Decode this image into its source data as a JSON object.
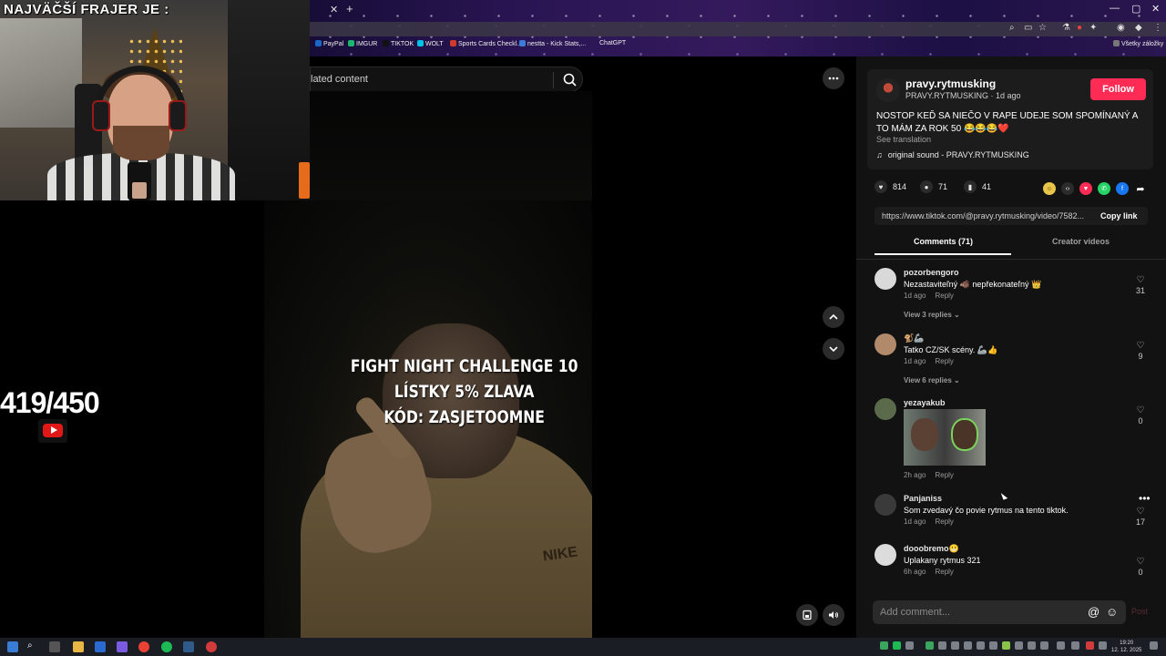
{
  "overlay": {
    "webcam_title": "NAJVÄČŠÍ FRAJER JE :",
    "counter": "419/450"
  },
  "bookmarks": [
    {
      "label": "PayPal",
      "color": "#1a66c9"
    },
    {
      "label": "IMGUR",
      "color": "#1bb76e"
    },
    {
      "label": "TIKTOK",
      "color": "#111111"
    },
    {
      "label": "WOLT",
      "color": "#00c2e8"
    },
    {
      "label": "Sports Cards Checkl...",
      "color": "#d0392b"
    },
    {
      "label": "nestta - Kick Stats,...",
      "color": "#3c7bd9"
    },
    {
      "label": "ChatGPT",
      "color": "#222222"
    },
    {
      "label": "Všetky záložky",
      "color": "#444444"
    }
  ],
  "search": {
    "placeholder": "lated content"
  },
  "video": {
    "caption_lines": [
      "FIGHT NIGHT CHALLENGE 10",
      "LÍSTKY 5% ZLAVA",
      "KÓD: ZASJETOOMNE"
    ],
    "brand_text": "NIKE"
  },
  "post": {
    "author": "pravy.rytmusking",
    "author_sub": "PRAVY.RYTMUSKING · 1d ago",
    "follow_label": "Follow",
    "description": "NOSTOP KEĎ SA NIEČO V RAPE UDEJE SOM SPOMÍNANÝ A TO MÁM ZA ROK 50 😂😂😂❤️",
    "see_translation": "See translation",
    "sound": "original sound - PRAVY.RYTMUSKING",
    "likes": "814",
    "comments": "71",
    "saves": "41",
    "link": "https://www.tiktok.com/@pravy.rytmusking/video/7582...",
    "copy_link": "Copy link",
    "tab_comments": "Comments (71)",
    "tab_creator": "Creator videos"
  },
  "comments": [
    {
      "user": "pozorbengoro",
      "text": "Nezastaviteľný 🐗 nepřekonateľný 👑",
      "time": "1d ago",
      "reply": "Reply",
      "likes": "31",
      "replies": "View 3 replies ⌄"
    },
    {
      "user": "🐒🦾",
      "text": "Tatko CZ/SK scény. 🦾👍",
      "time": "1d ago",
      "reply": "Reply",
      "likes": "9",
      "replies": "View 6 replies ⌄"
    },
    {
      "user": "yezayakub",
      "text": "",
      "time": "2h ago",
      "reply": "Reply",
      "likes": "0",
      "replies": ""
    },
    {
      "user": "Panjaniss",
      "text": "Som zvedavý čo povie rytmus na tento tiktok.",
      "time": "1d ago",
      "reply": "Reply",
      "likes": "17",
      "replies": ""
    },
    {
      "user": "dooobremo😬",
      "text": "Uplakany rytmus 321",
      "time": "6h ago",
      "reply": "Reply",
      "likes": "0",
      "replies": ""
    }
  ],
  "composer": {
    "placeholder": "Add comment...",
    "post_label": "Post"
  },
  "taskbar": {
    "time": "19:20",
    "date": "12. 12. 2025"
  }
}
